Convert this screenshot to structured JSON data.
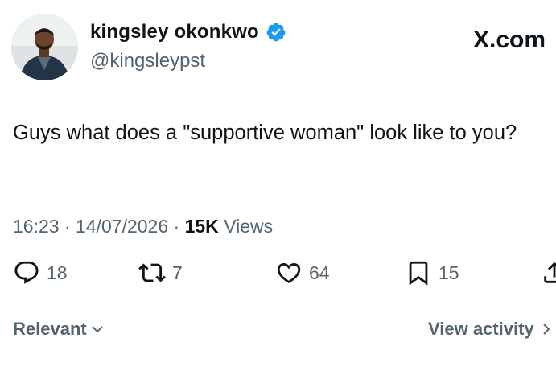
{
  "author": {
    "name": "kingsley okonkwo",
    "handle": "@kingsleypst",
    "verified": true
  },
  "site": "X.com",
  "tweet": {
    "text": "Guys what does a \"supportive woman\" look like to you?"
  },
  "meta": {
    "time": "16:23",
    "separator": "·",
    "date": "14/07/2026",
    "views_count": "15K",
    "views_label": "Views"
  },
  "actions": {
    "replies": "18",
    "reposts": "7",
    "likes": "64",
    "bookmarks": "15"
  },
  "footer": {
    "sort_label": "Relevant",
    "view_activity_label": "View activity"
  },
  "colors": {
    "text": "#0f1419",
    "secondary": "#536471",
    "verified": "#1d9bf0"
  }
}
